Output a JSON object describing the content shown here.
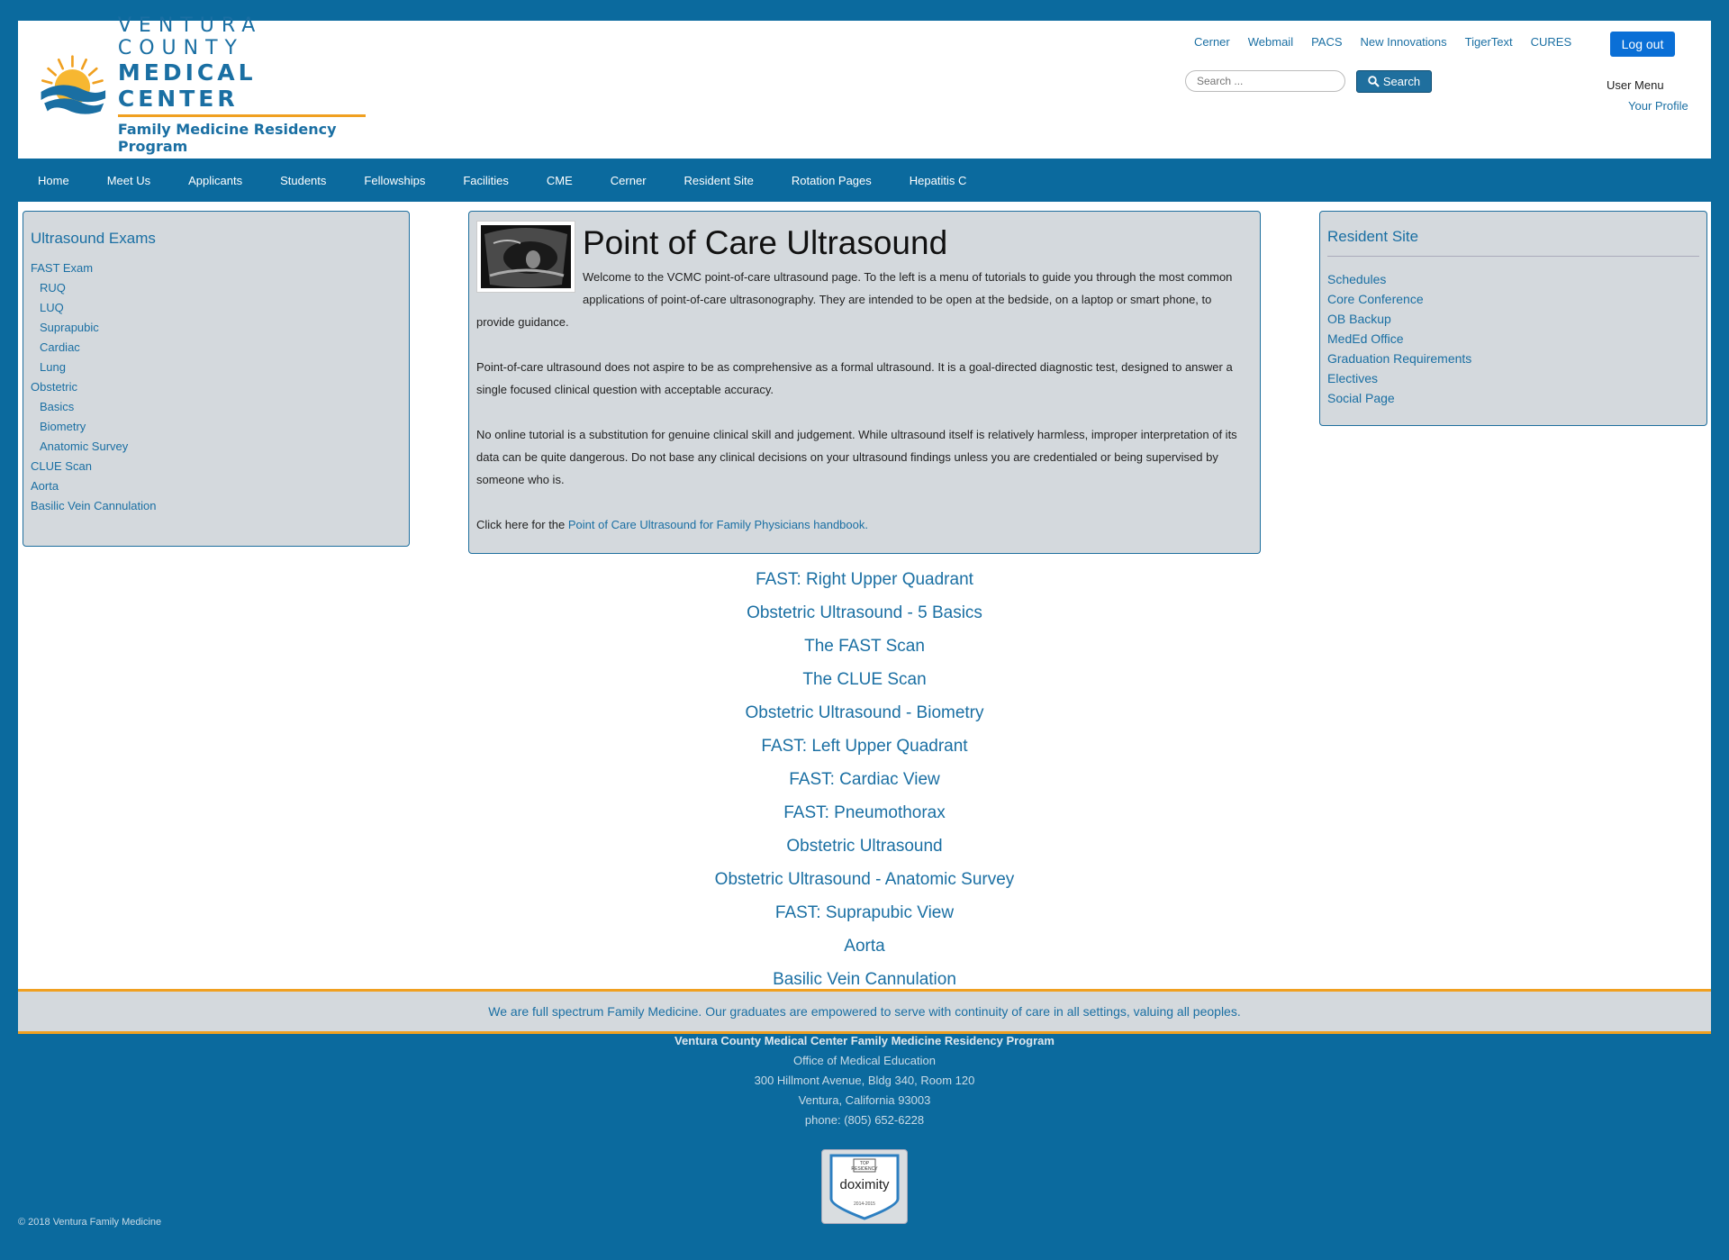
{
  "header": {
    "logo": {
      "line1": "VENTURA COUNTY",
      "line2": "MEDICAL CENTER",
      "line3": "Family Medicine Residency Program"
    },
    "top_links": [
      "Cerner",
      "Webmail",
      "PACS",
      "New Innovations",
      "TigerText",
      "CURES"
    ],
    "logout_label": "Log out",
    "search": {
      "placeholder": "Search ...",
      "button_label": "Search"
    },
    "user_menu": {
      "title": "User Menu",
      "profile_link": "Your Profile"
    }
  },
  "nav": {
    "items": [
      "Home",
      "Meet Us",
      "Applicants",
      "Students",
      "Fellowships",
      "Facilities",
      "CME",
      "Cerner",
      "Resident Site",
      "Rotation Pages",
      "Hepatitis C"
    ]
  },
  "left_panel": {
    "title": "Ultrasound Exams",
    "items": [
      {
        "label": "FAST Exam",
        "sub": false
      },
      {
        "label": "RUQ",
        "sub": true
      },
      {
        "label": "LUQ",
        "sub": true
      },
      {
        "label": "Suprapubic",
        "sub": true
      },
      {
        "label": "Cardiac",
        "sub": true
      },
      {
        "label": "Lung",
        "sub": true
      },
      {
        "label": "Obstetric",
        "sub": false
      },
      {
        "label": "Basics",
        "sub": true
      },
      {
        "label": "Biometry",
        "sub": true
      },
      {
        "label": "Anatomic Survey",
        "sub": true
      },
      {
        "label": "CLUE Scan",
        "sub": false
      },
      {
        "label": "Aorta",
        "sub": false
      },
      {
        "label": "Basilic Vein Cannulation",
        "sub": false
      }
    ]
  },
  "main": {
    "title": "Point of Care Ultrasound",
    "para1": "Welcome to the VCMC point-of-care ultrasound page.  To the left is a menu of tutorials to guide you through the most common applications of point-of-care ultrasonography.  They are intended to be open at the bedside, on a laptop or smart phone, to provide guidance.",
    "para2": "Point-of-care ultrasound does not aspire to be as comprehensive as a formal ultrasound.  It is a goal-directed diagnostic test, designed to answer a single focused clinical question with acceptable accuracy.",
    "para3": "No online tutorial is a substitution for genuine clinical skill and judgement.  While ultrasound itself is relatively harmless, improper interpretation of its data can be quite dangerous.  Do not base any clinical decisions on your ultrasound findings unless you are credentialed or being supervised by someone who is.",
    "handbook_prefix": "Click here for the ",
    "handbook_link": "Point of Care Ultrasound for Family Physicians handbook."
  },
  "right_panel": {
    "title": "Resident Site",
    "items": [
      "Schedules",
      "Core Conference",
      "OB Backup",
      "MedEd Office",
      "Graduation Requirements",
      "Electives",
      "Social Page"
    ]
  },
  "tutorials": [
    "FAST: Right Upper Quadrant",
    "Obstetric Ultrasound - 5 Basics",
    "The FAST Scan",
    "The CLUE Scan",
    "Obstetric Ultrasound - Biometry",
    "FAST: Left Upper Quadrant",
    "FAST: Cardiac View",
    "FAST: Pneumothorax",
    "Obstetric Ultrasound",
    "Obstetric Ultrasound - Anatomic Survey",
    "FAST: Suprapubic View",
    "Aorta",
    "Basilic Vein Cannulation"
  ],
  "footer": {
    "mission": "We are full spectrum Family Medicine. Our graduates are empowered to serve with continuity of care in all settings, valuing all peoples.",
    "org": "Ventura County Medical Center Family Medicine Residency Program",
    "office": "Office of Medical Education",
    "address1": "300 Hillmont Avenue, Bldg 340, Room 120",
    "address2": "Ventura, California 93003",
    "phone": "phone: (805) 652-6228",
    "badge": {
      "top": "TOP RESIDENCY",
      "brand": "doximity",
      "years": "2014-2015"
    },
    "copyright": "© 2018 Ventura Family Medicine"
  },
  "colors": {
    "brand_blue": "#0b6a9e",
    "link_blue": "#1a6fa3",
    "accent_orange": "#f0a020",
    "panel_gray": "#d4d9dd",
    "logout_blue": "#0a6fd6"
  }
}
